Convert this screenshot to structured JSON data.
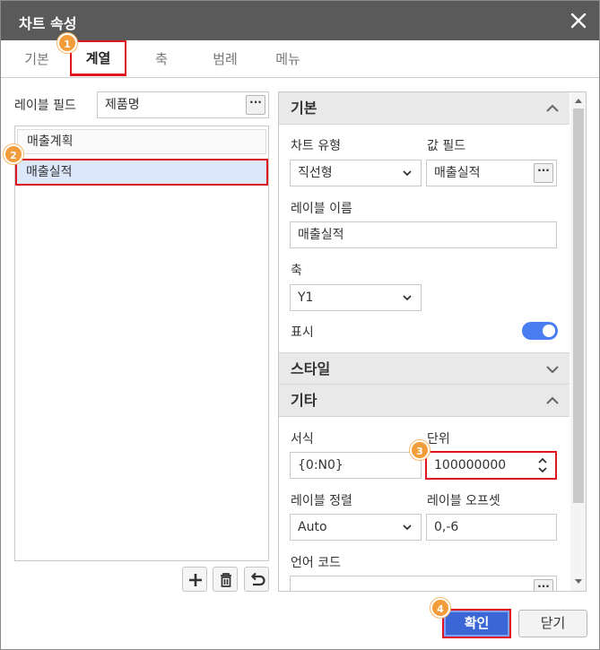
{
  "dialog": {
    "title": "차트 속성"
  },
  "tabs": [
    {
      "label": "기본"
    },
    {
      "label": "계열"
    },
    {
      "label": "축"
    },
    {
      "label": "범례"
    },
    {
      "label": "메뉴"
    }
  ],
  "left": {
    "label_field_label": "레이블 필드",
    "label_field_value": "제품명",
    "dots": "···",
    "series": [
      "매출계획",
      "매출실적"
    ]
  },
  "badges": [
    "1",
    "2",
    "3",
    "4"
  ],
  "panel": {
    "basic": {
      "header": "기본",
      "chart_type_label": "차트 유형",
      "chart_type_value": "직선형",
      "value_field_label": "값 필드",
      "value_field_value": "매출실적",
      "label_name_label": "레이블 이름",
      "label_name_value": "매출실적",
      "axis_label": "축",
      "axis_value": "Y1",
      "show_label": "표시",
      "show_on": true
    },
    "style": {
      "header": "스타일"
    },
    "etc": {
      "header": "기타",
      "format_label": "서식",
      "format_value": "{0:N0}",
      "unit_label": "단위",
      "unit_value": "100000000",
      "label_align_label": "레이블 정렬",
      "label_align_value": "Auto",
      "label_offset_label": "레이블 오프셋",
      "label_offset_value": "0,-6",
      "lang_code_label": "언어 코드",
      "lang_code_value": ""
    }
  },
  "footer": {
    "ok": "확인",
    "close": "닫기"
  },
  "colors": {
    "titlebar": "#5a5a5a",
    "accent": "#3b67d6",
    "highlight": "#e0141e",
    "badge": "#f39c3a",
    "selected_row": "#dce7fb"
  }
}
